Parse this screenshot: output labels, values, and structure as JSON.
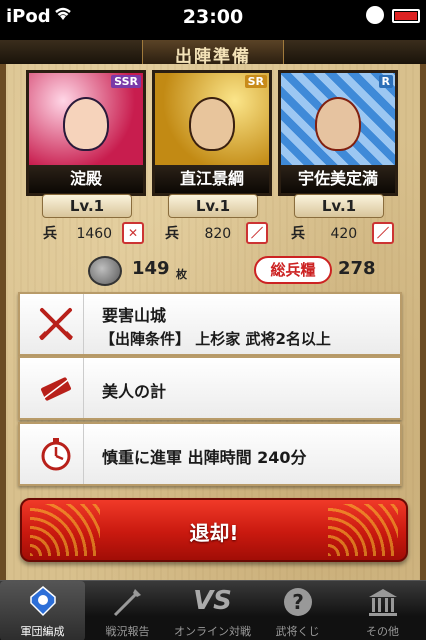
{
  "status_bar": {
    "carrier": "iPod",
    "time": "23:00"
  },
  "header": {
    "title": "出陣準備"
  },
  "cards": [
    {
      "name": "淀殿",
      "rarity": "SSR",
      "level": "Lv.1",
      "troops": "1460"
    },
    {
      "name": "直江景綱",
      "rarity": "SR",
      "level": "Lv.1",
      "troops": "820"
    },
    {
      "name": "宇佐美定満",
      "rarity": "R",
      "level": "Lv.1",
      "troops": "420"
    }
  ],
  "troop_glyph": "兵",
  "resources": {
    "gold": "149",
    "gold_unit": "枚",
    "provisions_label": "総兵糧",
    "provisions": "278"
  },
  "mission": {
    "castle": "要害山城",
    "condition": "【出陣条件】 上杉家 武将2名以上"
  },
  "strategy": {
    "label": "美人の計"
  },
  "march": {
    "label": "慎重に進軍 出陣時間 240分"
  },
  "retreat_button": {
    "label": "退却!"
  },
  "tabs": [
    {
      "label": "軍団編成",
      "icon": "armor-icon",
      "active": true
    },
    {
      "label": "戦況報告",
      "icon": "spear-icon",
      "active": false
    },
    {
      "label": "オンライン対戦",
      "icon": "vs-icon",
      "active": false
    },
    {
      "label": "武将くじ",
      "icon": "question-icon",
      "active": false
    },
    {
      "label": "その他",
      "icon": "temple-icon",
      "active": false
    }
  ],
  "colors": {
    "parchment": "#d8c08d",
    "accent_red": "#c9190f",
    "header_gold": "#f4e3b8"
  }
}
